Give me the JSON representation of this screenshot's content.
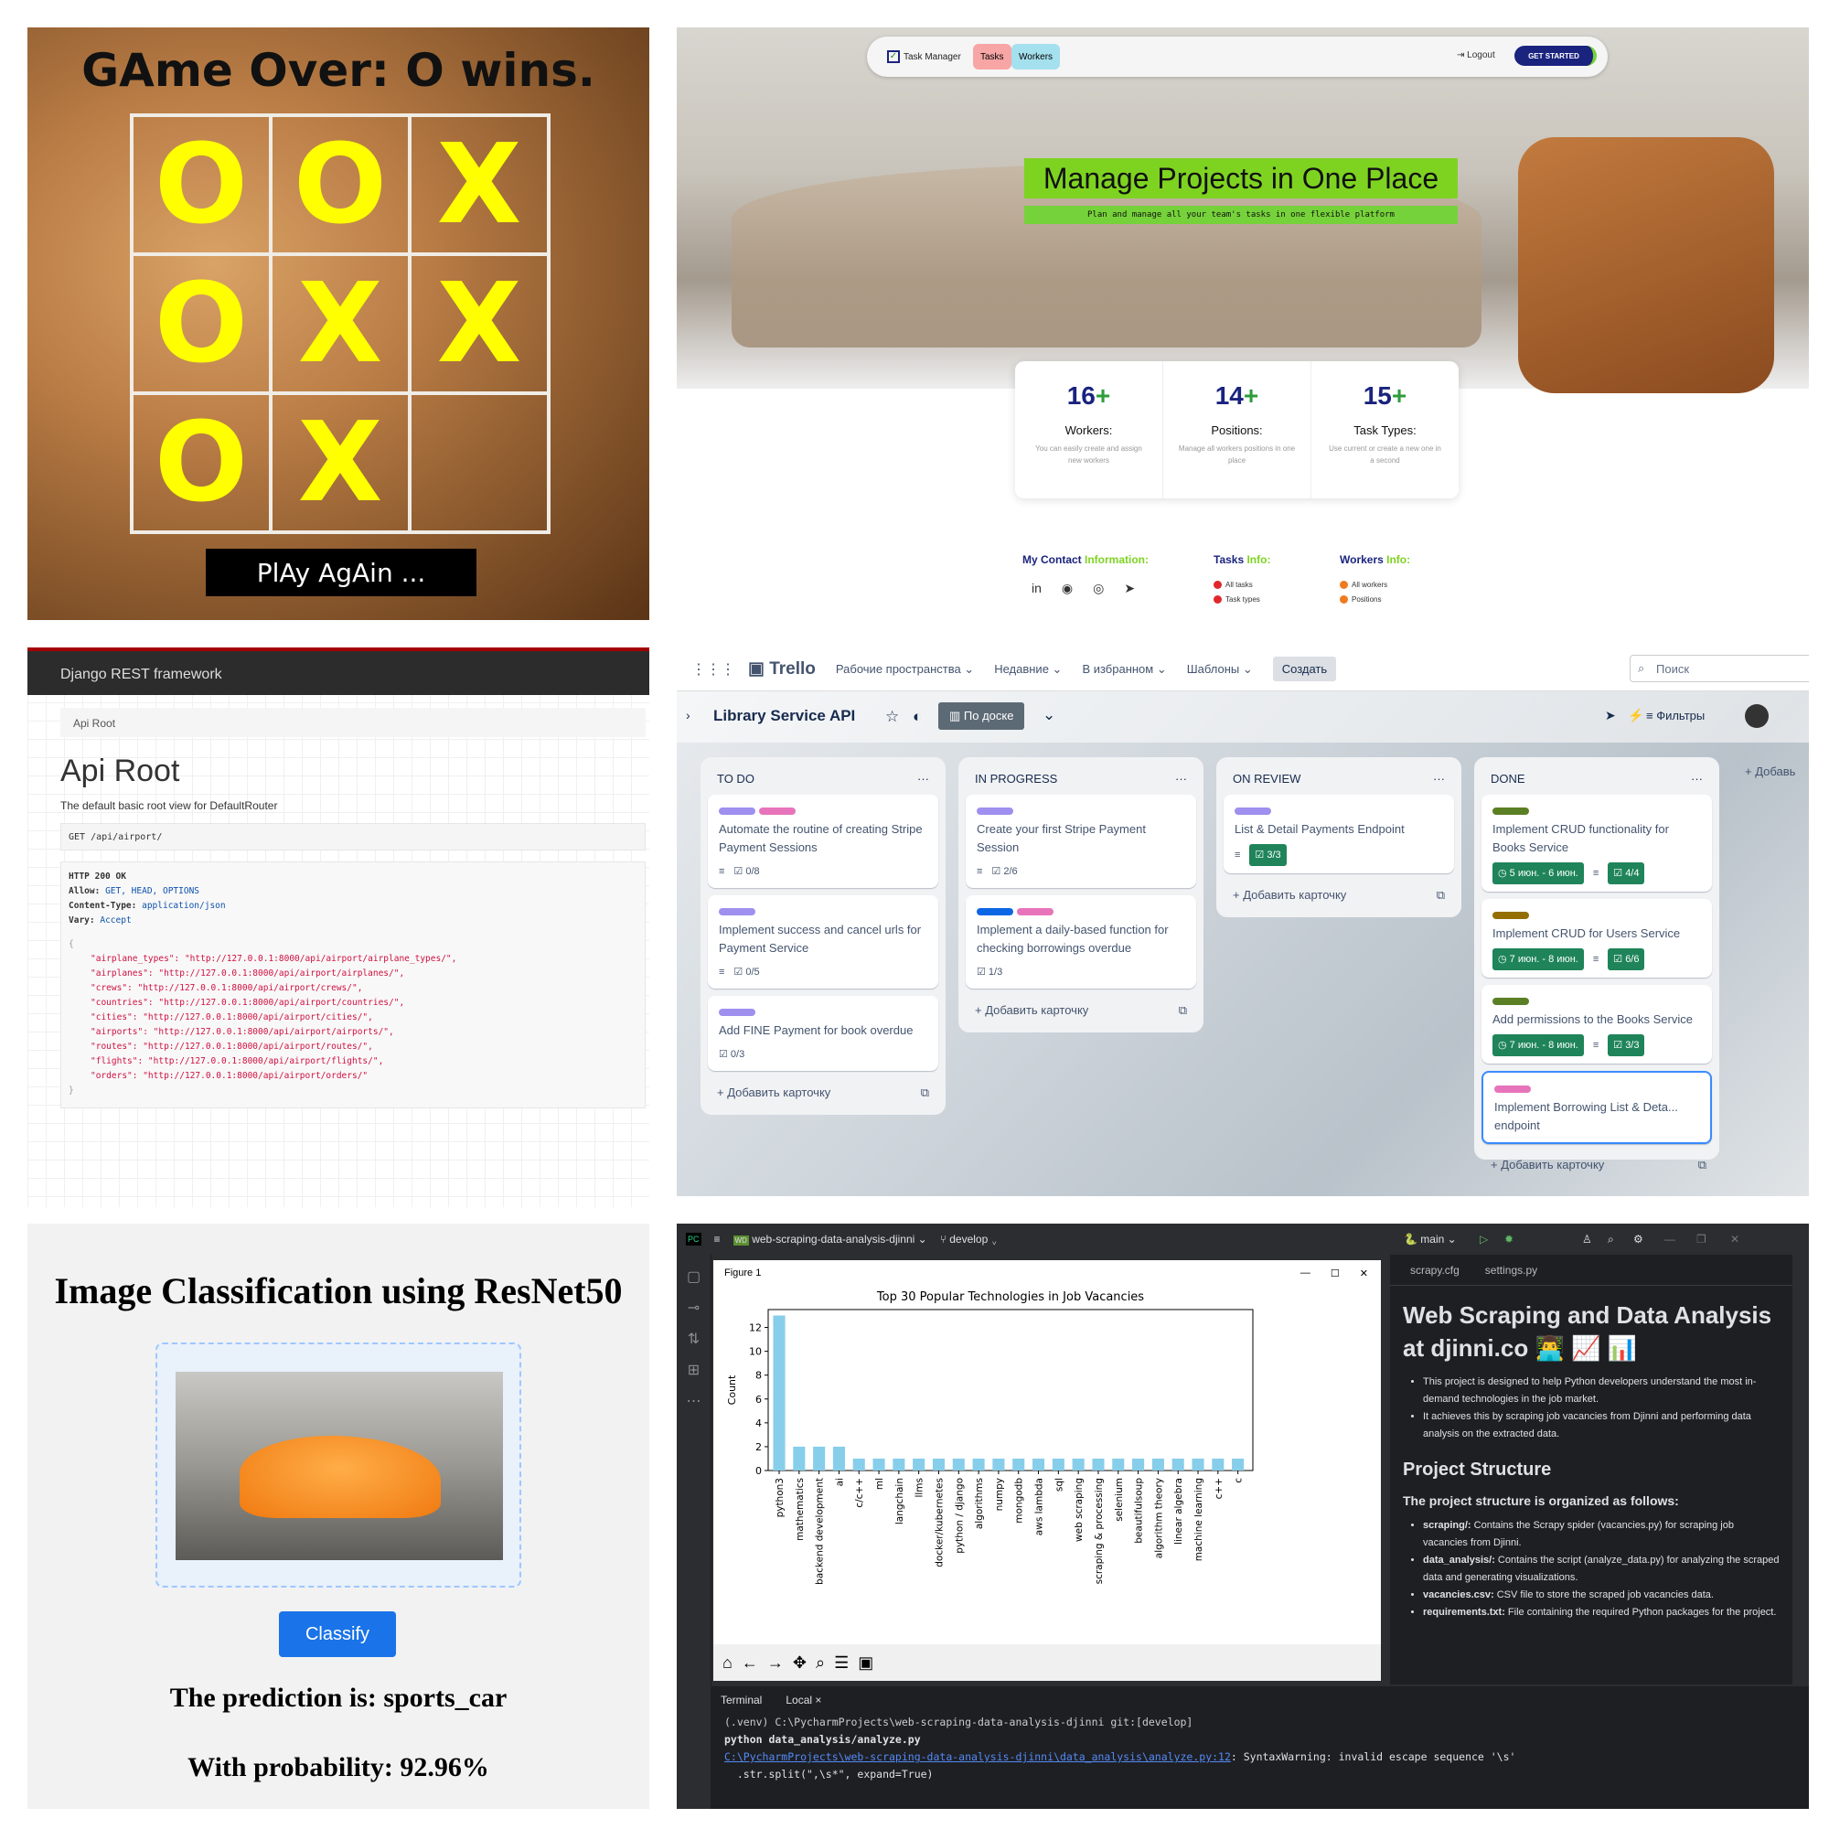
{
  "tictactoe": {
    "title": "GAme Over: O wins.",
    "cells": [
      "O",
      "O",
      "X",
      "O",
      "X",
      "X",
      "O",
      "X",
      ""
    ],
    "play_again": "PlAy AgAin ..."
  },
  "task_manager": {
    "brand": "Task Manager",
    "nav": {
      "tasks": "Tasks",
      "workers": "Workers",
      "logout": "Logout",
      "get_started": "GET STARTED"
    },
    "headline": "Manage Projects in One Place",
    "subheadline": "Plan and manage all your team's tasks in one flexible platform",
    "stats": [
      {
        "num": "16",
        "plus": "+",
        "label": "Workers:",
        "desc": "You can easily create and assign new workers"
      },
      {
        "num": "14",
        "plus": "+",
        "label": "Positions:",
        "desc": "Manage all workers positions in one place"
      },
      {
        "num": "15",
        "plus": "+",
        "label": "Task Types:",
        "desc": "Use current or create a new one in a second"
      }
    ],
    "footer": {
      "contact_a": "My Contact ",
      "contact_b": "Information:",
      "tasks_a": "Tasks ",
      "tasks_b": "Info:",
      "workers_a": "Workers ",
      "workers_b": "Info:",
      "tasks_links": [
        "All tasks",
        "Task types"
      ],
      "workers_links": [
        "All workers",
        "Positions"
      ]
    },
    "colors": {
      "accent": "#7ed321",
      "brand": "#1a237e",
      "tasks_pill": "#f8a5a5",
      "workers_pill": "#a5e0ee"
    }
  },
  "drf": {
    "topbar": "Django REST framework",
    "breadcrumb": "Api Root",
    "title": "Api Root",
    "description": "The default basic root view for DefaultRouter",
    "request": "GET /api/airport/",
    "status": "HTTP 200 OK",
    "allow_key": "Allow:",
    "allow_val": "GET, HEAD, OPTIONS",
    "ctype_key": "Content-Type:",
    "ctype_val": "application/json",
    "vary_key": "Vary:",
    "vary_val": "Accept",
    "brace_open": "{",
    "brace_close": "}",
    "json_lines": [
      "\"airplane_types\": \"http://127.0.0.1:8000/api/airport/airplane_types/\",",
      "\"airplanes\": \"http://127.0.0.1:8000/api/airport/airplanes/\",",
      "\"crews\": \"http://127.0.0.1:8000/api/airport/crews/\",",
      "\"countries\": \"http://127.0.0.1:8000/api/airport/countries/\",",
      "\"cities\": \"http://127.0.0.1:8000/api/airport/cities/\",",
      "\"airports\": \"http://127.0.0.1:8000/api/airport/airports/\",",
      "\"routes\": \"http://127.0.0.1:8000/api/airport/routes/\",",
      "\"flights\": \"http://127.0.0.1:8000/api/airport/flights/\",",
      "\"orders\": \"http://127.0.0.1:8000/api/airport/orders/\""
    ]
  },
  "trello": {
    "logo": "Trello",
    "menu": [
      "Рабочие пространства ⌄",
      "Недавние ⌄",
      "В избранном ⌄",
      "Шаблоны ⌄"
    ],
    "create": "Создать",
    "search": "Поиск",
    "board_title": "Library Service API",
    "view": "По доске",
    "filters": "Фильтры",
    "add_list": "+ Добавь",
    "add_card": "Добавить карточку",
    "lists": [
      {
        "name": "TO DO",
        "cards": [
          {
            "title": "Automate the routine of creating Stripe Payment Sessions",
            "badge": "0/8"
          },
          {
            "title": "Implement success and cancel urls for Payment Service",
            "badge": "0/5"
          },
          {
            "title": "Add FINE Payment for book overdue",
            "badge": "0/3"
          }
        ]
      },
      {
        "name": "IN PROGRESS",
        "cards": [
          {
            "title": "Create your first Stripe Payment Session",
            "badge": "2/6"
          },
          {
            "title": "Implement a daily-based function for checking borrowings overdue",
            "badge": "1/3"
          }
        ]
      },
      {
        "name": "ON REVIEW",
        "cards": [
          {
            "title": "List & Detail Payments Endpoint",
            "badge": "3/3"
          }
        ]
      },
      {
        "name": "DONE",
        "cards": [
          {
            "title": "Implement CRUD functionality for Books Service",
            "date": "5 июн. - 6 июн.",
            "badge": "4/4"
          },
          {
            "title": "Implement CRUD for Users Service",
            "date": "7 июн. - 8 июн.",
            "badge": "6/6"
          },
          {
            "title": "Add permissions to the Books Service",
            "date": "7 июн. - 8 июн.",
            "badge": "3/3"
          },
          {
            "title": "Implement Borrowing List & Deta... endpoint"
          }
        ]
      }
    ]
  },
  "classifier": {
    "title": "Image Classification using ResNet50",
    "button": "Classify",
    "prediction": "The prediction is: sports_car",
    "probability": "With probability: 92.96%"
  },
  "ide": {
    "project": "web-scraping-data-analysis-djinni ⌄",
    "branch": "develop ⌄",
    "run_branch": "main ⌄",
    "figure_title": "Figure 1",
    "tabs": [
      "scrapy.cfg",
      "settings.py"
    ],
    "readme": {
      "h1": "Web Scraping and Data Analysis at djinni.co 👨‍💻 📈 📊",
      "bullets1": [
        "This project is designed to help Python developers understand the most in-demand technologies in the job market.",
        "It achieves this by scraping job vacancies from Djinni and performing data analysis on the extracted data."
      ],
      "h2": "Project Structure",
      "h3": "The project structure is organized as follows:",
      "bullets2": [
        {
          "k": "scraping/:",
          "v": " Contains the Scrapy spider (vacancies.py) for scraping job vacancies from Djinni."
        },
        {
          "k": "data_analysis/:",
          "v": " Contains the script (analyze_data.py) for analyzing the scraped data and generating visualizations."
        },
        {
          "k": "vacancies.csv:",
          "v": " CSV file to store the scraped job vacancies data."
        },
        {
          "k": "requirements.txt:",
          "v": " File containing the required Python packages for the project."
        }
      ]
    },
    "terminal_tabs": [
      "Terminal",
      "Local ×"
    ],
    "terminal": {
      "prompt": "(.venv) C:\\PycharmProjects\\web-scraping-data-analysis-djinni git:[develop]",
      "cmd": "python data_analysis/analyze.py",
      "warn_link": "C:\\PycharmProjects\\web-scraping-data-analysis-djinni\\data_analysis\\analyze.py:12",
      "warn_text": ": SyntaxWarning: invalid escape sequence '\\s'",
      "code": "  .str.split(\",\\s*\", expand=True)"
    }
  },
  "chart_data": {
    "type": "bar",
    "title": "Top 30 Popular Technologies in Job Vacancies",
    "ylabel": "Count",
    "xlabel": "",
    "ylim": [
      0,
      13.5
    ],
    "yticks": [
      0,
      2,
      4,
      6,
      8,
      10,
      12
    ],
    "categories": [
      "python3",
      "mathematics",
      "backend development",
      "ai",
      "c/c++",
      "ml",
      "langchain",
      "llms",
      "docker/kubernetes",
      "python / django",
      "algorithms",
      "numpy",
      "mongodb",
      "aws lambda",
      "sql",
      "web scraping",
      "scraping & processing",
      "selenium",
      "beautifulsoup",
      "algorithm theory",
      "linear algebra",
      "machine learning",
      "c++",
      "c"
    ],
    "values": [
      13,
      2,
      2,
      2,
      1,
      1,
      1,
      1,
      1,
      1,
      1,
      1,
      1,
      1,
      1,
      1,
      1,
      1,
      1,
      1,
      1,
      1,
      1,
      1
    ],
    "color": "#87ceeb"
  }
}
